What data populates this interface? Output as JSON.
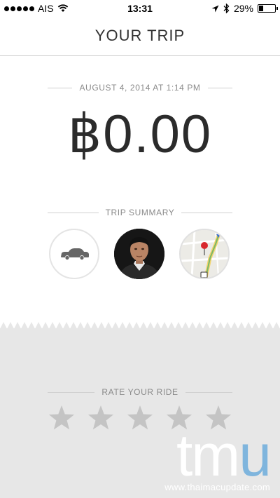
{
  "status_bar": {
    "carrier": "AIS",
    "time": "13:31",
    "battery": "29%",
    "battery_level": 0.29,
    "signal_dots": 5,
    "icons": [
      "wifi-icon",
      "location-arrow-icon",
      "bluetooth-icon",
      "battery-icon"
    ]
  },
  "header": {
    "title": "YOUR TRIP"
  },
  "trip": {
    "datetime": "AUGUST 4, 2014 AT 1:14 PM",
    "fare": "฿0.00"
  },
  "summary": {
    "label": "TRIP SUMMARY",
    "items": [
      {
        "icon": "car-icon"
      },
      {
        "icon": "driver-photo"
      },
      {
        "icon": "route-map-thumbnail"
      }
    ]
  },
  "rating": {
    "label": "RATE YOUR RIDE",
    "stars": 5,
    "selected": 0
  },
  "watermark": {
    "logo_tm": "tm",
    "logo_u": "u",
    "url": "www.thaimacupdate.com"
  },
  "colors": {
    "divider": "#cfcfcf",
    "rate_background": "#e7e7e7",
    "star": "#c4c4c4",
    "text_muted": "#8a8a8a"
  }
}
